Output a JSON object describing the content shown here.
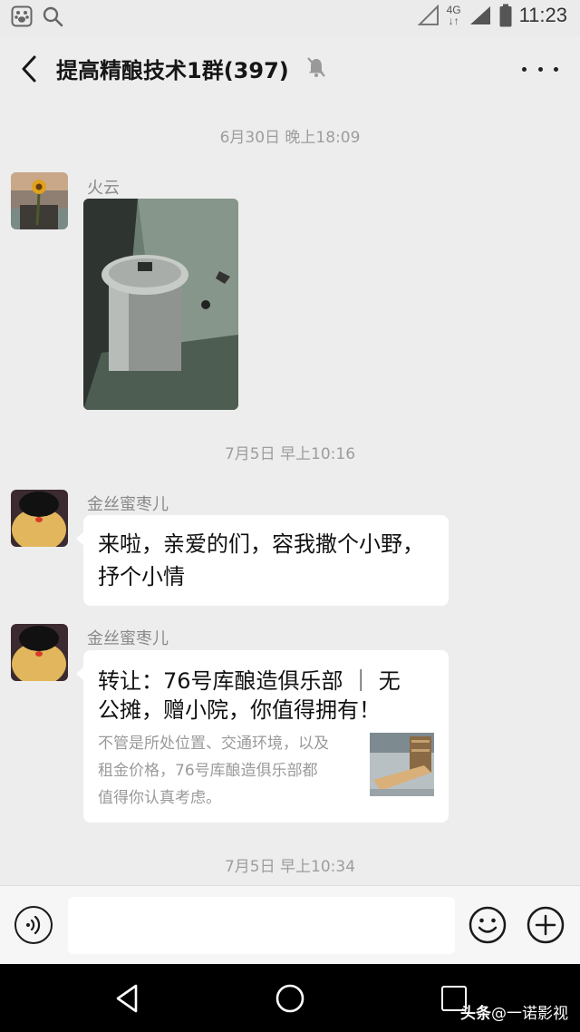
{
  "status_bar": {
    "network": "4G",
    "time": "11:23"
  },
  "header": {
    "title": "提高精酿技术1群(397)"
  },
  "messages": [
    {
      "type": "timestamp",
      "text": "6月30日 晚上18:09"
    },
    {
      "type": "image",
      "sender": "火云"
    },
    {
      "type": "timestamp",
      "text": "7月5日 早上10:16"
    },
    {
      "type": "text",
      "sender": "金丝蜜枣儿",
      "lines": [
        "来啦，亲爱的们，容我撒个小野，",
        "抒个小情"
      ]
    },
    {
      "type": "link",
      "sender": "金丝蜜枣儿",
      "title_lines": [
        "转让：76号库酿造俱乐部 ｜ 无",
        "公摊，赠小院，你值得拥有！"
      ],
      "desc_lines": [
        "不管是所处位置、交通环境，以及",
        "租金价格，76号库酿造俱乐部都",
        "值得你认真考虑。"
      ]
    },
    {
      "type": "timestamp",
      "text": "7月5日 早上10:34"
    }
  ],
  "input": {
    "value": "",
    "placeholder": ""
  },
  "watermark": {
    "brand": "头条",
    "handle": "@一诺影视"
  }
}
